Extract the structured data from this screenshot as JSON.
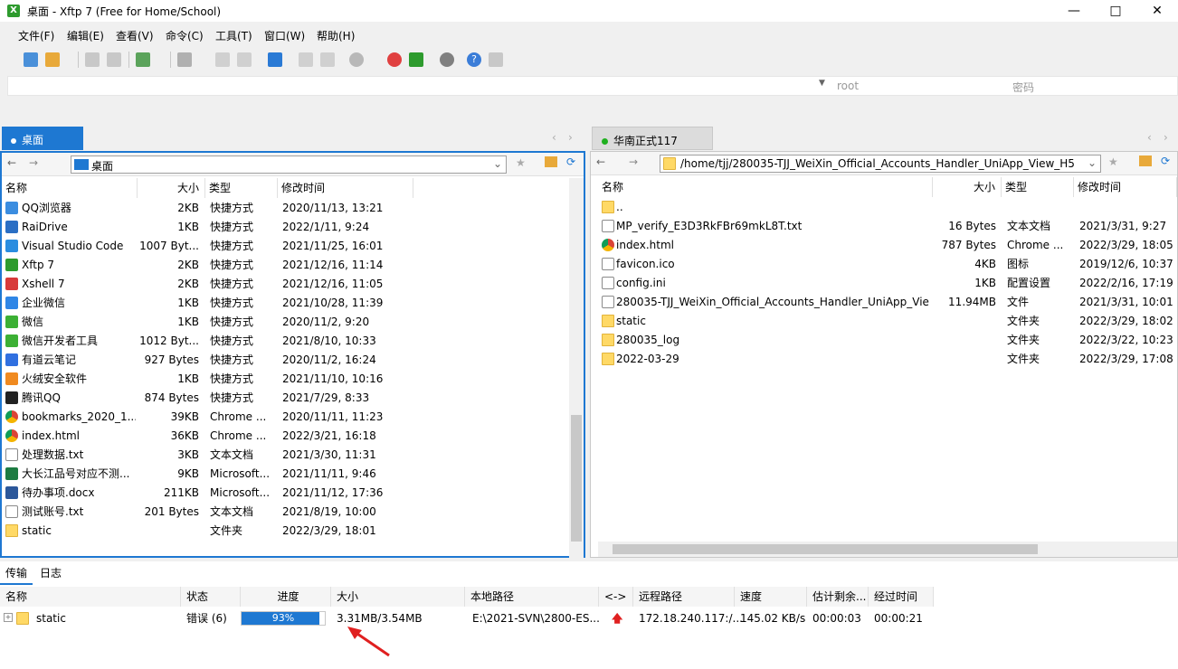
{
  "window": {
    "title": "桌面 - Xftp 7 (Free for Home/School)",
    "app_icon_letter": "X"
  },
  "menu": [
    "文件(F)",
    "编辑(E)",
    "查看(V)",
    "命令(C)",
    "工具(T)",
    "窗口(W)",
    "帮助(H)"
  ],
  "address": {
    "user_placeholder": "root",
    "password_placeholder": "密码"
  },
  "left": {
    "tab": "桌面",
    "path": "桌面",
    "columns": [
      "名称",
      "大小",
      "类型",
      "修改时间"
    ],
    "rows": [
      {
        "name": "QQ浏览器",
        "size": "2KB",
        "type": "快捷方式",
        "mtime": "2020/11/13, 13:21",
        "icon": "qqbrowser"
      },
      {
        "name": "RaiDrive",
        "size": "1KB",
        "type": "快捷方式",
        "mtime": "2022/1/11, 9:24",
        "icon": "raidrive"
      },
      {
        "name": "Visual Studio Code",
        "size": "1007 Byt...",
        "type": "快捷方式",
        "mtime": "2021/11/25, 16:01",
        "icon": "vscode"
      },
      {
        "name": "Xftp 7",
        "size": "2KB",
        "type": "快捷方式",
        "mtime": "2021/12/16, 11:14",
        "icon": "xftp"
      },
      {
        "name": "Xshell 7",
        "size": "2KB",
        "type": "快捷方式",
        "mtime": "2021/12/16, 11:05",
        "icon": "xshell"
      },
      {
        "name": "企业微信",
        "size": "1KB",
        "type": "快捷方式",
        "mtime": "2021/10/28, 11:39",
        "icon": "wecom"
      },
      {
        "name": "微信",
        "size": "1KB",
        "type": "快捷方式",
        "mtime": "2020/11/2, 9:20",
        "icon": "wechat"
      },
      {
        "name": "微信开发者工具",
        "size": "1012 Byt...",
        "type": "快捷方式",
        "mtime": "2021/8/10, 10:33",
        "icon": "wechat-dev"
      },
      {
        "name": "有道云笔记",
        "size": "927 Bytes",
        "type": "快捷方式",
        "mtime": "2020/11/2, 16:24",
        "icon": "youdao"
      },
      {
        "name": "火绒安全软件",
        "size": "1KB",
        "type": "快捷方式",
        "mtime": "2021/11/10, 10:16",
        "icon": "huorong"
      },
      {
        "name": "腾讯QQ",
        "size": "874 Bytes",
        "type": "快捷方式",
        "mtime": "2021/7/29, 8:33",
        "icon": "qq"
      },
      {
        "name": "bookmarks_2020_1...",
        "size": "39KB",
        "type": "Chrome ...",
        "mtime": "2020/11/11, 11:23",
        "icon": "chrome"
      },
      {
        "name": "index.html",
        "size": "36KB",
        "type": "Chrome ...",
        "mtime": "2022/3/21, 16:18",
        "icon": "chrome"
      },
      {
        "name": "处理数据.txt",
        "size": "3KB",
        "type": "文本文档",
        "mtime": "2021/3/30, 11:31",
        "icon": "doc"
      },
      {
        "name": "大长江品号对应不测...",
        "size": "9KB",
        "type": "Microsoft...",
        "mtime": "2021/11/11, 9:46",
        "icon": "excel"
      },
      {
        "name": "待办事项.docx",
        "size": "211KB",
        "type": "Microsoft...",
        "mtime": "2021/11/12, 17:36",
        "icon": "word"
      },
      {
        "name": "测试账号.txt",
        "size": "201 Bytes",
        "type": "文本文档",
        "mtime": "2021/8/19, 10:00",
        "icon": "doc"
      },
      {
        "name": "static",
        "size": "",
        "type": "文件夹",
        "mtime": "2022/3/29, 18:01",
        "icon": "folder"
      }
    ]
  },
  "right": {
    "tab": "华南正式117",
    "path": "/home/tjj/280035-TJJ_WeiXin_Official_Accounts_Handler_UniApp_View_H5",
    "columns": [
      "名称",
      "大小",
      "类型",
      "修改时间"
    ],
    "rows": [
      {
        "name": "..",
        "size": "",
        "type": "",
        "mtime": "",
        "icon": "folder"
      },
      {
        "name": "MP_verify_E3D3RkFBr69mkL8T.txt",
        "size": "16 Bytes",
        "type": "文本文档",
        "mtime": "2021/3/31, 9:27",
        "icon": "doc"
      },
      {
        "name": "index.html",
        "size": "787 Bytes",
        "type": "Chrome ...",
        "mtime": "2022/3/29, 18:05",
        "icon": "chrome"
      },
      {
        "name": "favicon.ico",
        "size": "4KB",
        "type": "图标",
        "mtime": "2019/12/6, 10:37",
        "icon": "doc"
      },
      {
        "name": "config.ini",
        "size": "1KB",
        "type": "配置设置",
        "mtime": "2022/2/16, 17:19",
        "icon": "doc"
      },
      {
        "name": "280035-TJJ_WeiXin_Official_Accounts_Handler_UniApp_Vie...",
        "size": "11.94MB",
        "type": "文件",
        "mtime": "2021/3/31, 10:01",
        "icon": "doc"
      },
      {
        "name": "static",
        "size": "",
        "type": "文件夹",
        "mtime": "2022/3/29, 18:02",
        "icon": "folder"
      },
      {
        "name": "280035_log",
        "size": "",
        "type": "文件夹",
        "mtime": "2022/3/22, 10:23",
        "icon": "folder"
      },
      {
        "name": "2022-03-29",
        "size": "",
        "type": "文件夹",
        "mtime": "2022/3/29, 17:08",
        "icon": "folder"
      }
    ]
  },
  "bottom": {
    "tabs": [
      "传输",
      "日志"
    ],
    "columns": [
      "名称",
      "状态",
      "进度",
      "大小",
      "本地路径",
      "<->",
      "远程路径",
      "速度",
      "估计剩余...",
      "经过时间"
    ],
    "transfer": {
      "name": "static",
      "status": "错误 (6)",
      "progress_label": "93%",
      "progress": 0.93,
      "size": "3.31MB/3.54MB",
      "local_path": "E:\\2021-SVN\\2800-ES...",
      "remote_path": "172.18.240.117:/...",
      "speed": "145.02 KB/s",
      "remaining": "00:00:03",
      "elapsed": "00:00:21"
    }
  },
  "colors": {
    "accent": "#1e78d2",
    "folder": "#ffd966",
    "arrow": "#e02020"
  }
}
